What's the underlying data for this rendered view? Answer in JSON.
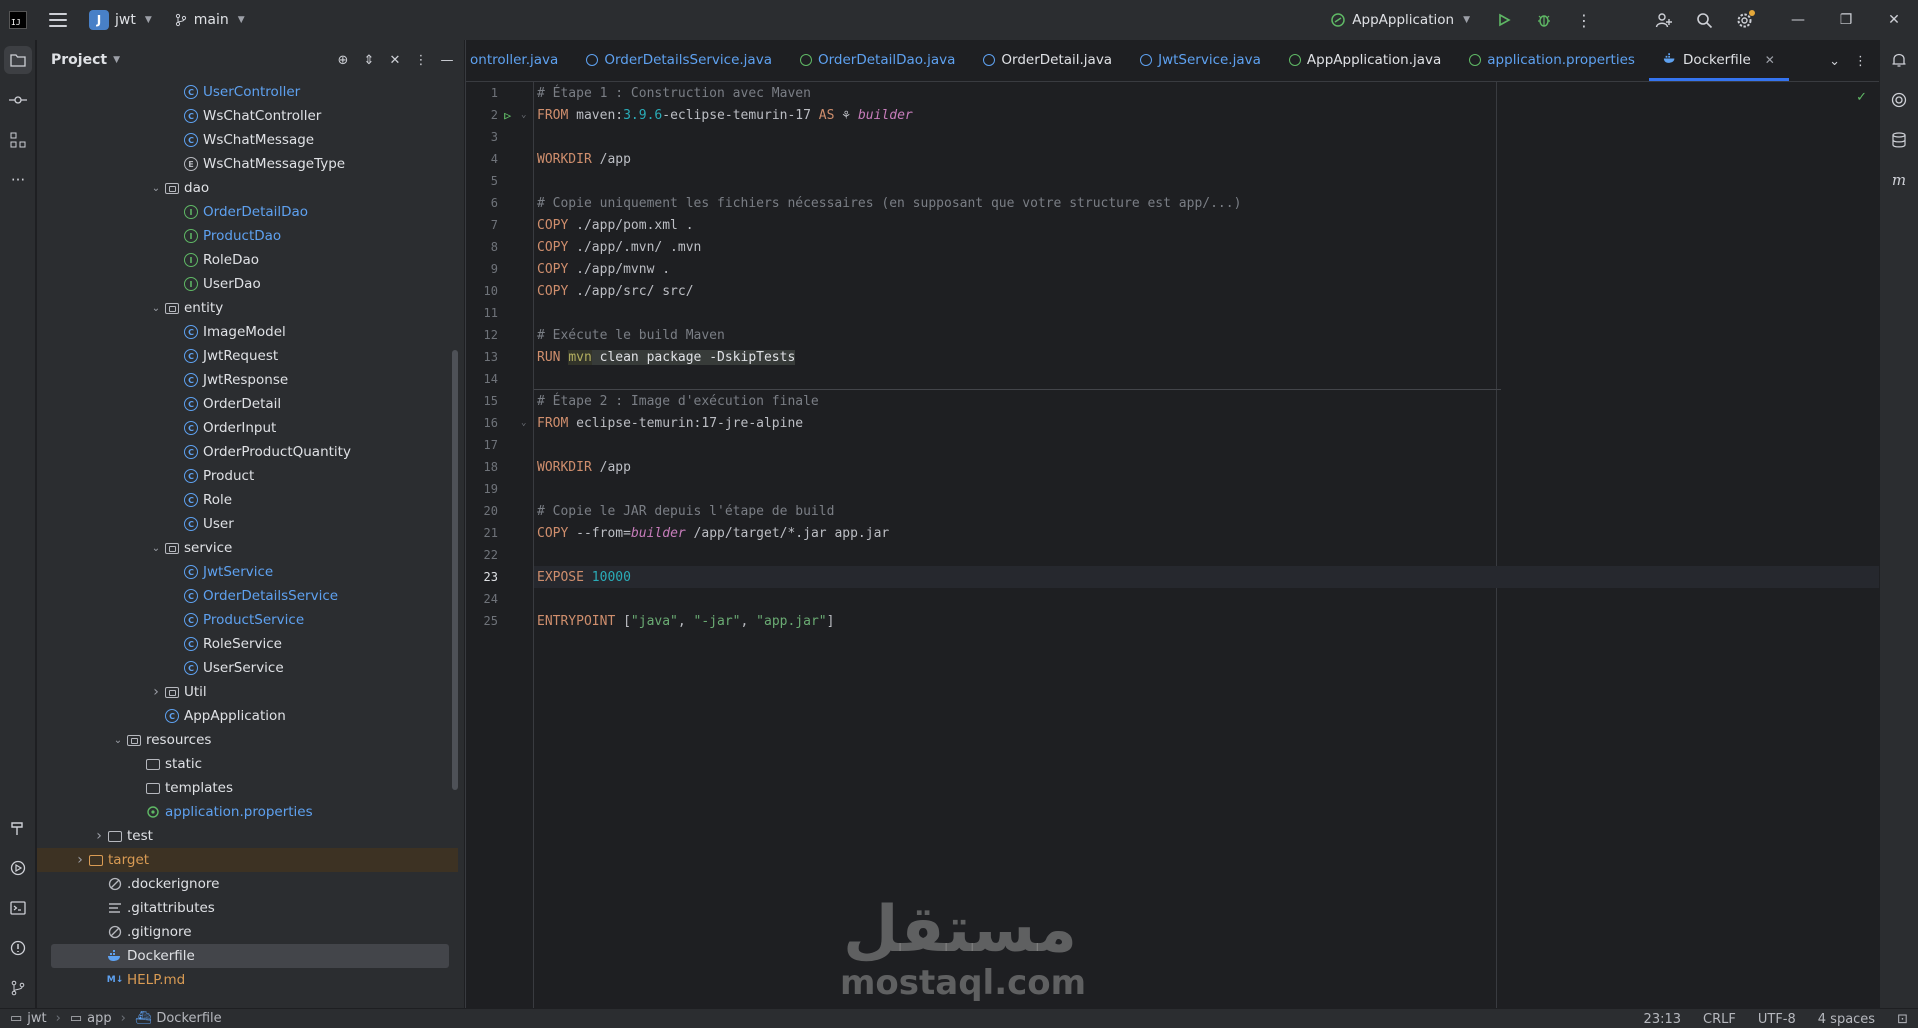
{
  "titlebar": {
    "logo": "IJ",
    "project_badge": "J",
    "project_name": "jwt",
    "branch": "main",
    "run_config": "AppApplication"
  },
  "project_panel": {
    "title": "Project",
    "tree": [
      {
        "label": "UserController",
        "kind": "class",
        "indent": 7,
        "color": "blue"
      },
      {
        "label": "WsChatController",
        "kind": "class",
        "indent": 7,
        "color": "norm"
      },
      {
        "label": "WsChatMessage",
        "kind": "class",
        "indent": 7,
        "color": "norm"
      },
      {
        "label": "WsChatMessageType",
        "kind": "enum",
        "indent": 7,
        "color": "norm"
      },
      {
        "label": "dao",
        "kind": "package",
        "indent": 6,
        "expanded": true,
        "color": "norm"
      },
      {
        "label": "OrderDetailDao",
        "kind": "interface",
        "indent": 7,
        "color": "blue"
      },
      {
        "label": "ProductDao",
        "kind": "interface",
        "indent": 7,
        "color": "blue"
      },
      {
        "label": "RoleDao",
        "kind": "interface",
        "indent": 7,
        "color": "norm"
      },
      {
        "label": "UserDao",
        "kind": "interface",
        "indent": 7,
        "color": "norm"
      },
      {
        "label": "entity",
        "kind": "package",
        "indent": 6,
        "expanded": true,
        "color": "norm"
      },
      {
        "label": "ImageModel",
        "kind": "class",
        "indent": 7,
        "color": "norm"
      },
      {
        "label": "JwtRequest",
        "kind": "class",
        "indent": 7,
        "color": "norm"
      },
      {
        "label": "JwtResponse",
        "kind": "class",
        "indent": 7,
        "color": "norm"
      },
      {
        "label": "OrderDetail",
        "kind": "class",
        "indent": 7,
        "color": "norm"
      },
      {
        "label": "OrderInput",
        "kind": "class",
        "indent": 7,
        "color": "norm"
      },
      {
        "label": "OrderProductQuantity",
        "kind": "class",
        "indent": 7,
        "color": "norm"
      },
      {
        "label": "Product",
        "kind": "class",
        "indent": 7,
        "color": "norm"
      },
      {
        "label": "Role",
        "kind": "class",
        "indent": 7,
        "color": "norm"
      },
      {
        "label": "User",
        "kind": "class",
        "indent": 7,
        "color": "norm"
      },
      {
        "label": "service",
        "kind": "package",
        "indent": 6,
        "expanded": true,
        "color": "norm"
      },
      {
        "label": "JwtService",
        "kind": "class",
        "indent": 7,
        "color": "blue"
      },
      {
        "label": "OrderDetailsService",
        "kind": "class",
        "indent": 7,
        "color": "blue"
      },
      {
        "label": "ProductService",
        "kind": "class",
        "indent": 7,
        "color": "blue"
      },
      {
        "label": "RoleService",
        "kind": "class",
        "indent": 7,
        "color": "norm"
      },
      {
        "label": "UserService",
        "kind": "class",
        "indent": 7,
        "color": "norm"
      },
      {
        "label": "Util",
        "kind": "package",
        "indent": 6,
        "expanded": false,
        "color": "norm"
      },
      {
        "label": "AppApplication",
        "kind": "springclass",
        "indent": 6,
        "color": "norm"
      },
      {
        "label": "resources",
        "kind": "resfolder",
        "indent": 4,
        "expanded": true,
        "color": "norm"
      },
      {
        "label": "static",
        "kind": "folder",
        "indent": 5,
        "color": "norm"
      },
      {
        "label": "templates",
        "kind": "folder",
        "indent": 5,
        "color": "norm"
      },
      {
        "label": "application.properties",
        "kind": "props",
        "indent": 5,
        "color": "blue"
      },
      {
        "label": "test",
        "kind": "folder",
        "indent": 3,
        "expanded": false,
        "color": "norm"
      },
      {
        "label": "target",
        "kind": "folder-excluded",
        "indent": 2,
        "expanded": false,
        "color": "orange"
      },
      {
        "label": ".dockerignore",
        "kind": "ignore",
        "indent": 3,
        "color": "norm"
      },
      {
        "label": ".gitattributes",
        "kind": "text",
        "indent": 3,
        "color": "norm"
      },
      {
        "label": ".gitignore",
        "kind": "ignore",
        "indent": 3,
        "color": "norm"
      },
      {
        "label": "Dockerfile",
        "kind": "docker",
        "indent": 3,
        "color": "norm",
        "selected": true
      },
      {
        "label": "HELP.md",
        "kind": "markdown",
        "indent": 3,
        "color": "orange"
      }
    ]
  },
  "tabs": [
    {
      "label": "ontroller.java",
      "icon": "none",
      "active": false
    },
    {
      "label": "OrderDetailsService.java",
      "icon": "class",
      "active": false
    },
    {
      "label": "OrderDetailDao.java",
      "icon": "interface",
      "active": false
    },
    {
      "label": "OrderDetail.java",
      "icon": "class",
      "active": false,
      "plain": true
    },
    {
      "label": "JwtService.java",
      "icon": "class",
      "active": false
    },
    {
      "label": "AppApplication.java",
      "icon": "spring",
      "active": false,
      "plain": true
    },
    {
      "label": "application.properties",
      "icon": "props",
      "active": false
    },
    {
      "label": "Dockerfile",
      "icon": "docker",
      "active": true
    }
  ],
  "editor": {
    "current_line": 23,
    "lines": [
      {
        "n": 1,
        "tokens": [
          [
            "c-comment",
            "# Étape 1 : Construction avec Maven"
          ]
        ]
      },
      {
        "n": 2,
        "run": true,
        "fold": true,
        "tokens": [
          [
            "c-kw",
            "FROM "
          ],
          [
            "c-text",
            "maven:"
          ],
          [
            "c-num",
            "3.9.6"
          ],
          [
            "c-text",
            "-eclipse-temurin-17 "
          ],
          [
            "c-kw",
            "AS "
          ],
          [
            "c-text",
            "⚘ "
          ],
          [
            "c-italic",
            "builder"
          ]
        ]
      },
      {
        "n": 3,
        "tokens": []
      },
      {
        "n": 4,
        "tokens": [
          [
            "c-kw",
            "WORKDIR "
          ],
          [
            "c-text",
            "/app"
          ]
        ]
      },
      {
        "n": 5,
        "tokens": []
      },
      {
        "n": 6,
        "tokens": [
          [
            "c-comment",
            "# Copie uniquement les fichiers nécessaires (en supposant que votre structure est app/...)"
          ]
        ]
      },
      {
        "n": 7,
        "tokens": [
          [
            "c-kw",
            "COPY "
          ],
          [
            "c-text",
            "./app/pom.xml ."
          ]
        ]
      },
      {
        "n": 8,
        "tokens": [
          [
            "c-kw",
            "COPY "
          ],
          [
            "c-text",
            "./app/.mvn/ .mvn"
          ]
        ]
      },
      {
        "n": 9,
        "tokens": [
          [
            "c-kw",
            "COPY "
          ],
          [
            "c-text",
            "./app/mvnw ."
          ]
        ]
      },
      {
        "n": 10,
        "tokens": [
          [
            "c-kw",
            "COPY "
          ],
          [
            "c-text",
            "./app/src/ src/"
          ]
        ]
      },
      {
        "n": 11,
        "tokens": []
      },
      {
        "n": 12,
        "tokens": [
          [
            "c-comment",
            "# Exécute le build Maven"
          ]
        ]
      },
      {
        "n": 13,
        "tokens": [
          [
            "c-kw",
            "RUN "
          ],
          [
            "c-mvn",
            "mvn"
          ],
          [
            "c-hl",
            " clean package -DskipTests"
          ]
        ]
      },
      {
        "n": 14,
        "sep": true,
        "tokens": []
      },
      {
        "n": 15,
        "tokens": [
          [
            "c-comment",
            "# Étape 2 : Image d'exécution finale"
          ]
        ]
      },
      {
        "n": 16,
        "fold": true,
        "tokens": [
          [
            "c-kw",
            "FROM "
          ],
          [
            "c-text",
            "eclipse-temurin:17-jre-alpine"
          ]
        ]
      },
      {
        "n": 17,
        "tokens": []
      },
      {
        "n": 18,
        "tokens": [
          [
            "c-kw",
            "WORKDIR "
          ],
          [
            "c-text",
            "/app"
          ]
        ]
      },
      {
        "n": 19,
        "tokens": []
      },
      {
        "n": 20,
        "tokens": [
          [
            "c-comment",
            "# Copie le JAR depuis l'étape de build"
          ]
        ]
      },
      {
        "n": 21,
        "tokens": [
          [
            "c-kw",
            "COPY "
          ],
          [
            "c-text",
            "--from="
          ],
          [
            "c-italic",
            "builder"
          ],
          [
            "c-text",
            " /app/target/*.jar app.jar"
          ]
        ]
      },
      {
        "n": 22,
        "tokens": []
      },
      {
        "n": 23,
        "tokens": [
          [
            "c-kw",
            "EXPOSE "
          ],
          [
            "c-num",
            "10000"
          ]
        ]
      },
      {
        "n": 24,
        "tokens": []
      },
      {
        "n": 25,
        "tokens": [
          [
            "c-kw",
            "ENTRYPOINT "
          ],
          [
            "c-text",
            "["
          ],
          [
            "c-str",
            "\"java\""
          ],
          [
            "c-text",
            ", "
          ],
          [
            "c-str",
            "\"-jar\""
          ],
          [
            "c-text",
            ", "
          ],
          [
            "c-str",
            "\"app.jar\""
          ],
          [
            "c-text",
            "]"
          ]
        ]
      }
    ]
  },
  "statusbar": {
    "crumbs": [
      "jwt",
      "app",
      "Dockerfile"
    ],
    "position": "23:13",
    "line_sep": "CRLF",
    "encoding": "UTF-8",
    "indent": "4 spaces"
  },
  "watermark": {
    "arabic": "مستقل",
    "latin": "mostaql.com"
  }
}
